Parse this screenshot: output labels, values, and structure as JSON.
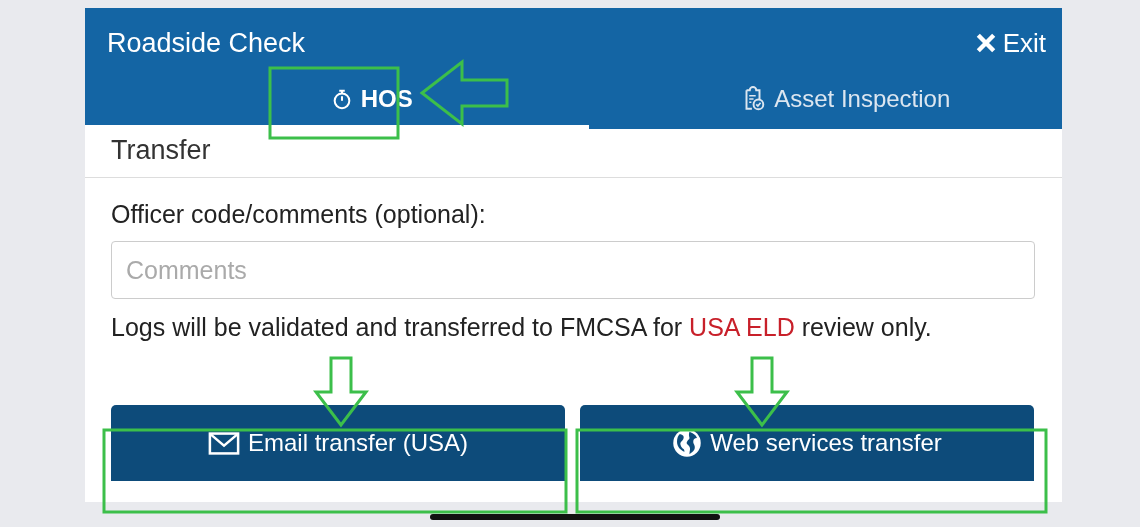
{
  "header": {
    "title": "Roadside Check",
    "exit_label": "Exit"
  },
  "tabs": [
    {
      "label": "HOS",
      "kind": "stopwatch",
      "selected": true
    },
    {
      "label": "Asset Inspection",
      "kind": "clipboard",
      "selected": false
    }
  ],
  "section_title": "Transfer",
  "comments_field": {
    "label": "Officer code/comments (optional):",
    "placeholder": "Comments"
  },
  "notice": {
    "before": "Logs will be validated and transferred to FMCSA for",
    "highlight": "USA ELD",
    "after": "review only."
  },
  "buttons": [
    {
      "label": "Email transfer (USA)",
      "kind": "email"
    },
    {
      "label": "Web services transfer",
      "kind": "web"
    }
  ]
}
